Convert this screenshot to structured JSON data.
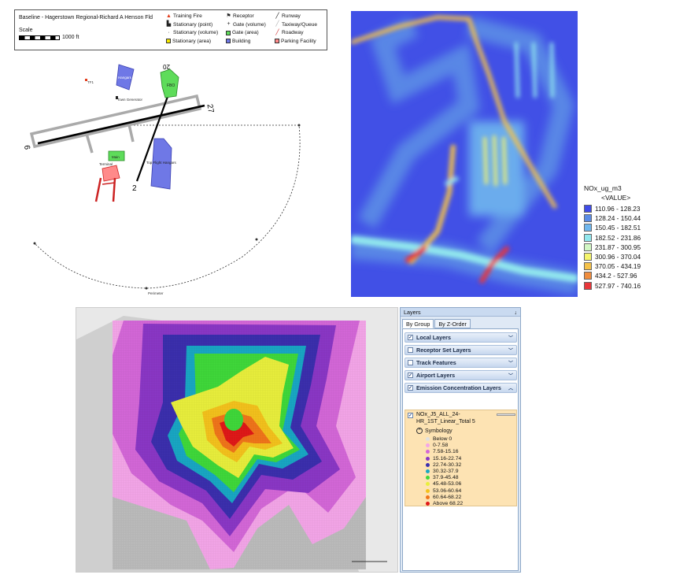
{
  "airport_map": {
    "title": "Baseline - Hagerstown Regional-Richard A Henson Fld",
    "scale_label": "Scale",
    "scale_value": "1000 ft",
    "legend": [
      {
        "label": "Training Fire",
        "glyph": "fire",
        "color": "#e23b1a"
      },
      {
        "label": "Stationary (point)",
        "glyph": "stack",
        "color": "#222222"
      },
      {
        "label": "Stationary (volume)",
        "glyph": "dot",
        "color": "#222222"
      },
      {
        "label": "Stationary (area)",
        "glyph": "box",
        "color": "#f5e800"
      },
      {
        "label": "Receptor",
        "glyph": "flag",
        "color": "#222222"
      },
      {
        "label": "Gate (volume)",
        "glyph": "plus",
        "color": "#222222"
      },
      {
        "label": "Gate (area)",
        "glyph": "box",
        "color": "#5edc5a"
      },
      {
        "label": "Building",
        "glyph": "box",
        "color": "#6f78e6"
      },
      {
        "label": "Runway",
        "glyph": "line",
        "color": "#000000"
      },
      {
        "label": "Taxiway/Queue",
        "glyph": "line",
        "color": "#aaaaaa"
      },
      {
        "label": "Roadway",
        "glyph": "line",
        "color": "#cc2222"
      },
      {
        "label": "Parking Facility",
        "glyph": "box",
        "color": "#ff8a8a"
      }
    ],
    "labels": {
      "hangars": "Hangars",
      "fbo": "FBO",
      "town_generator": "Town Generator",
      "tf1": "TF1",
      "main": "Main",
      "top_flight": "Top Flight Hangars",
      "perimeter": "Perimeter",
      "runway_27": "27",
      "runway_9": "9",
      "runway_2": "2",
      "runway_20": "20",
      "terminal": "Terminal"
    }
  },
  "raster_legend": {
    "title": "NOx_ug_m3",
    "subtitle": "<VALUE>",
    "classes": [
      {
        "label": "110.96 - 128.23",
        "color": "#3f4ce8"
      },
      {
        "label": "128.24 - 150.44",
        "color": "#5b8de6"
      },
      {
        "label": "150.45 - 182.51",
        "color": "#6fb7ee"
      },
      {
        "label": "182.52 - 231.86",
        "color": "#92e8ee"
      },
      {
        "label": "231.87 - 300.95",
        "color": "#d2f7c4"
      },
      {
        "label": "300.96 - 370.04",
        "color": "#f5f56c"
      },
      {
        "label": "370.05 - 434.19",
        "color": "#f5c24a"
      },
      {
        "label": "434.2 - 527.96",
        "color": "#f08d3e"
      },
      {
        "label": "527.97 - 740.16",
        "color": "#e8363a"
      }
    ]
  },
  "layers_pane": {
    "title": "Layers",
    "pin": "↓",
    "tabs": [
      {
        "label": "By Group",
        "active": true
      },
      {
        "label": "By Z-Order",
        "active": false
      }
    ],
    "groups": [
      {
        "label": "Local Layers",
        "checked": true,
        "expanded": false
      },
      {
        "label": "Receptor Set Layers",
        "checked": false,
        "expanded": false
      },
      {
        "label": "Track Features",
        "checked": false,
        "expanded": false
      },
      {
        "label": "Airport Layers",
        "checked": true,
        "expanded": false
      },
      {
        "label": "Emission Concentration Layers",
        "checked": true,
        "expanded": true
      }
    ],
    "active_layer": {
      "name_line1": "NOx_J5_ALL_24-",
      "name_line2": "HR_1ST_Linear_Total 5",
      "symbology_label": "Symbology",
      "classes": [
        {
          "label": "Below 0",
          "color": "#e0e0e0"
        },
        {
          "label": "0-7.58",
          "color": "#f4a6e8"
        },
        {
          "label": "7.58-15.16",
          "color": "#d467d8"
        },
        {
          "label": "15.16-22.74",
          "color": "#8a37c6"
        },
        {
          "label": "22.74-30.32",
          "color": "#3b2fae"
        },
        {
          "label": "30.32-37.9",
          "color": "#19a7c4"
        },
        {
          "label": "37.9-45.48",
          "color": "#3fd83a"
        },
        {
          "label": "45.48-53.06",
          "color": "#e9ef3c"
        },
        {
          "label": "53.06-60.64",
          "color": "#f4c21c"
        },
        {
          "label": "60.64-68.22",
          "color": "#f0751a"
        },
        {
          "label": "Above 68.22",
          "color": "#e01818"
        }
      ]
    }
  }
}
